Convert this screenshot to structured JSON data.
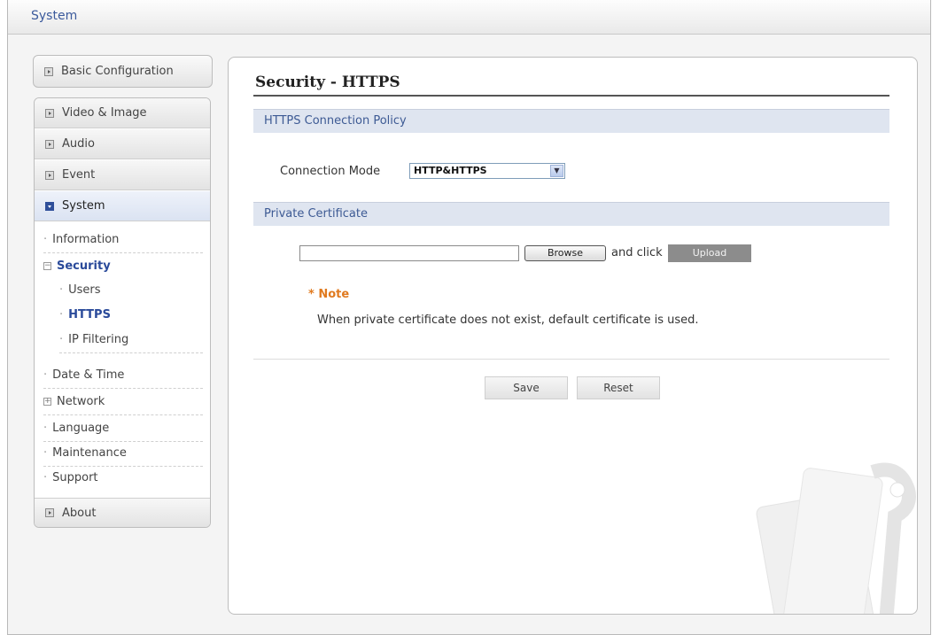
{
  "topbar": {
    "title": "System"
  },
  "sidebar": {
    "basic": "Basic Configuration",
    "video": "Video & Image",
    "audio": "Audio",
    "event": "Event",
    "system": "System",
    "information": "Information",
    "security": "Security",
    "users": "Users",
    "https": "HTTPS",
    "ip_filtering": "IP Filtering",
    "date_time": "Date & Time",
    "network": "Network",
    "language": "Language",
    "maintenance": "Maintenance",
    "support": "Support",
    "about": "About"
  },
  "main": {
    "title": "Security - HTTPS",
    "policy_header": "HTTPS Connection Policy",
    "connection_mode_label": "Connection Mode",
    "connection_mode_value": "HTTP&HTTPS",
    "cert_header": "Private Certificate",
    "browse_label": "Browse",
    "and_click": "and click",
    "upload_label": "Upload",
    "note_title": "* Note",
    "note_text": "When private certificate does not exist, default certificate is used.",
    "save_label": "Save",
    "reset_label": "Reset"
  },
  "colors": {
    "accent": "#3b5a9c",
    "note": "#e07a1f",
    "section_bg": "#dfe5f0"
  }
}
